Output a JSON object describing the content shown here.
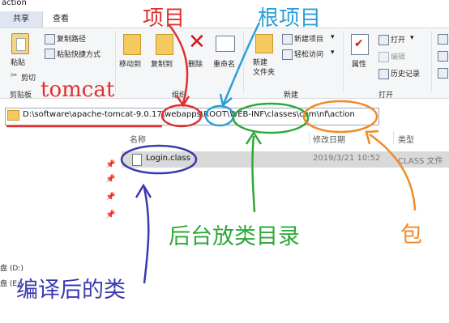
{
  "window": {
    "title": "action"
  },
  "tabs": [
    {
      "label": "共享"
    },
    {
      "label": "查看"
    }
  ],
  "ribbon": {
    "clipboard": {
      "paste_label": "粘贴",
      "copy_path_label": "复制路径",
      "paste_shortcut_label": "粘贴快捷方式",
      "cut_label": "剪切",
      "group_label": "剪贴板"
    },
    "organize": {
      "move_to_label": "移动到",
      "copy_to_label": "复制到",
      "delete_label": "删除",
      "rename_label": "重命名",
      "group_label": "组织"
    },
    "new": {
      "new_folder_label": "新建\n文件夹",
      "new_item_label": "新建项目",
      "easy_access_label": "轻松访问",
      "group_label": "新建"
    },
    "open": {
      "properties_label": "属性",
      "open_label": "打开",
      "edit_label": "编辑",
      "history_label": "历史记录",
      "group_label": "打开"
    }
  },
  "address": {
    "path": "D:\\software\\apache-tomcat-9.0.17\\webapps\\ROOT\\WEB-INF\\classes\\com\\nf\\action"
  },
  "columns": {
    "name": "名称",
    "date": "修改日期",
    "type": "类型"
  },
  "files": [
    {
      "name": "Login.class",
      "date": "2019/3/21 10:52",
      "type": "CLASS 文件"
    }
  ],
  "drives": [
    {
      "label": "盘 (D:)"
    },
    {
      "label": "盘 (E:)"
    }
  ],
  "annotations": {
    "project": "项目",
    "root_project": "根项目",
    "tomcat": "tomcat",
    "classes_dir": "后台放类目录",
    "package": "包",
    "compiled_class": "编译后的类"
  },
  "colors": {
    "red": "#e03030",
    "blue": "#2a9fd8",
    "green": "#2fa83a",
    "orange": "#f08a28",
    "navy": "#3a3ab0"
  }
}
